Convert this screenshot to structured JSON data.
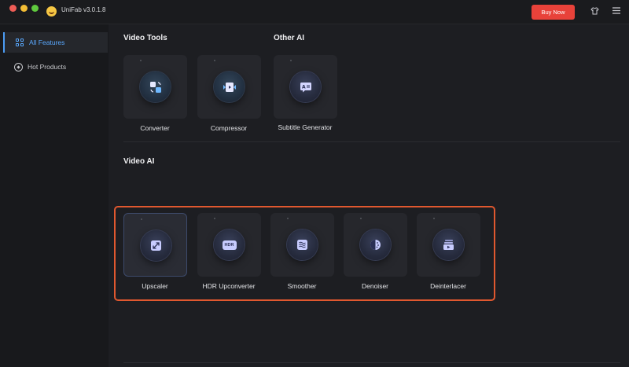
{
  "window": {
    "title": "UniFab v3.0.1.8",
    "buy_button": "Buy Now",
    "icons": [
      "app-logo-icon",
      "shirt-icon",
      "menu-icon"
    ]
  },
  "sidebar": {
    "items": [
      {
        "label": "All Features",
        "icon": "grid-icon",
        "active": true
      },
      {
        "label": "Hot Products",
        "icon": "compass-icon",
        "active": false
      }
    ]
  },
  "sections": {
    "video_tools": {
      "title": "Video Tools",
      "items": [
        {
          "label": "Converter",
          "icon": "convert-icon"
        },
        {
          "label": "Compressor",
          "icon": "compress-icon"
        }
      ]
    },
    "other_ai": {
      "title": "Other AI",
      "items": [
        {
          "label": "Subtitle Generator",
          "icon": "subtitle-icon"
        }
      ]
    },
    "video_ai": {
      "title": "Video AI",
      "items": [
        {
          "label": "Upscaler",
          "icon": "upscale-icon",
          "glyph": "↗"
        },
        {
          "label": "HDR Upconverter",
          "icon": "hdr-icon",
          "glyph": "HDR"
        },
        {
          "label": "Smoother",
          "icon": "smoother-icon",
          "glyph": "≋"
        },
        {
          "label": "Denoiser",
          "icon": "denoise-icon",
          "glyph": "◐"
        },
        {
          "label": "Deinterlacer",
          "icon": "deinterlace-icon",
          "glyph": "▶"
        }
      ]
    }
  },
  "colors": {
    "accent": "#4c9cf5",
    "buy": "#e8423a",
    "highlight": "#e0582f"
  }
}
